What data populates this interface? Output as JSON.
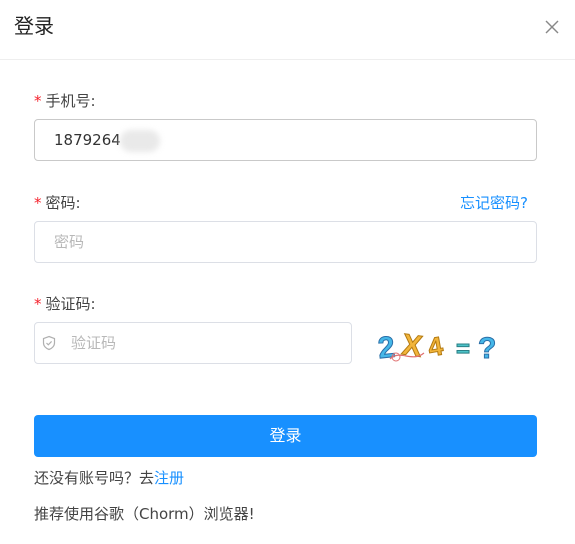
{
  "dialog": {
    "title": "登录",
    "close_icon": "close-icon"
  },
  "form": {
    "required_mark": "*",
    "phone": {
      "label": "手机号:",
      "value": "1879264"
    },
    "password": {
      "label": "密码:",
      "placeholder": "密码",
      "forgot_label": "忘记密码?"
    },
    "captcha": {
      "label": "验证码:",
      "placeholder": "验证码",
      "icon": "shield-icon",
      "image_text": "2X4=?"
    },
    "submit_label": "登录",
    "register_prompt": "还没有账号吗？去",
    "register_link": "注册",
    "browser_tip": "推荐使用谷歌（Chorm）浏览器!"
  },
  "colors": {
    "primary": "#1890ff",
    "required": "#f5222d",
    "placeholder": "#b8b8b8"
  }
}
